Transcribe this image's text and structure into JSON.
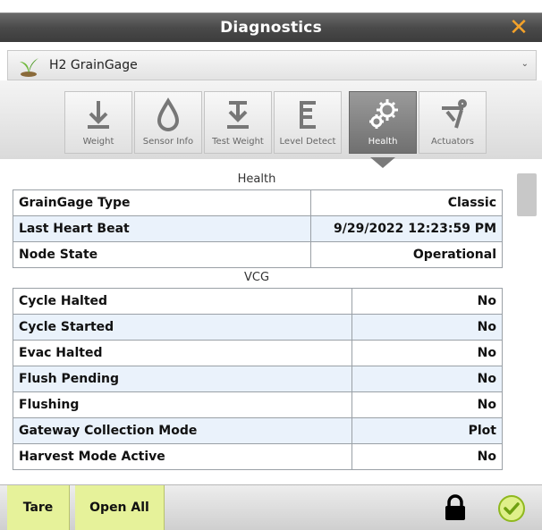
{
  "window": {
    "title": "Diagnostics",
    "close_icon": "close-icon",
    "accent": "#f4a22a"
  },
  "device": {
    "name": "H2 GrainGage",
    "icon": "plant-sensor-icon"
  },
  "tabs": [
    {
      "label": "Weight",
      "icon": "weight-download-icon"
    },
    {
      "label": "Sensor Info",
      "icon": "droplet-icon"
    },
    {
      "label": "Test Weight",
      "icon": "test-weight-icon"
    },
    {
      "label": "Level Detect",
      "icon": "level-detect-icon"
    },
    {
      "label": "Health",
      "icon": "gears-icon",
      "active": true
    },
    {
      "label": "Actuators",
      "icon": "actuator-icon"
    }
  ],
  "sections": {
    "health": {
      "title": "Health",
      "rows": [
        {
          "label": "GrainGage Type",
          "value": "Classic"
        },
        {
          "label": "Last Heart Beat",
          "value": "9/29/2022 12:23:59 PM"
        },
        {
          "label": "Node State",
          "value": "Operational"
        }
      ]
    },
    "vcg": {
      "title": "VCG",
      "rows": [
        {
          "label": "Cycle Halted",
          "value": "No"
        },
        {
          "label": "Cycle Started",
          "value": "No"
        },
        {
          "label": "Evac Halted",
          "value": "No"
        },
        {
          "label": "Flush Pending",
          "value": "No"
        },
        {
          "label": "Flushing",
          "value": "No"
        },
        {
          "label": "Gateway Collection Mode",
          "value": "Plot"
        },
        {
          "label": "Harvest Mode Active",
          "value": "No"
        }
      ]
    }
  },
  "footer": {
    "tare_label": "Tare",
    "open_all_label": "Open All",
    "button_color": "#e6f29a",
    "lock_icon": "lock-icon",
    "ok_icon": "check-circle-icon"
  }
}
